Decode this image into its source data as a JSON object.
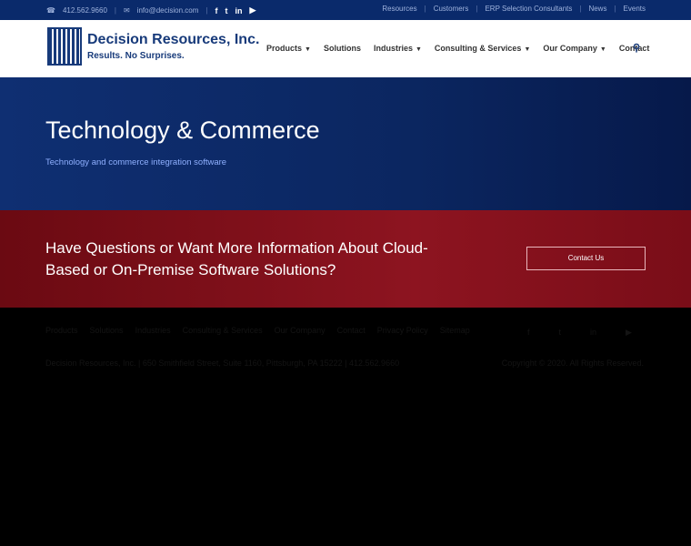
{
  "topbar": {
    "phone": "412.562.9660",
    "email": "info@decision.com",
    "links": [
      "Resources",
      "Customers",
      "ERP Selection Consultants",
      "News",
      "Events"
    ]
  },
  "logo": {
    "name": "Decision Resources, Inc.",
    "tagline": "Results. No Surprises."
  },
  "nav": {
    "items": [
      "Products",
      "Solutions",
      "Industries",
      "Consulting & Services",
      "Our Company",
      "Contact"
    ]
  },
  "hero": {
    "title": "Technology & Commerce",
    "subtitle": "Technology and commerce integration software"
  },
  "cta": {
    "heading": "Have Questions or Want More Information About Cloud-Based or On-Premise Software Solutions?",
    "button": "Contact Us"
  },
  "footer": {
    "links": [
      "Products",
      "Solutions",
      "Industries",
      "Consulting & Services",
      "Our Company",
      "Contact",
      "Privacy Policy",
      "Sitemap"
    ],
    "address": "Decision Resources, Inc. | 650 Smithfield Street, Suite 1160, Pittsburgh, PA 15222 | 412.562.9660",
    "copyright": "Copyright © 2020. All Rights Reserved."
  }
}
